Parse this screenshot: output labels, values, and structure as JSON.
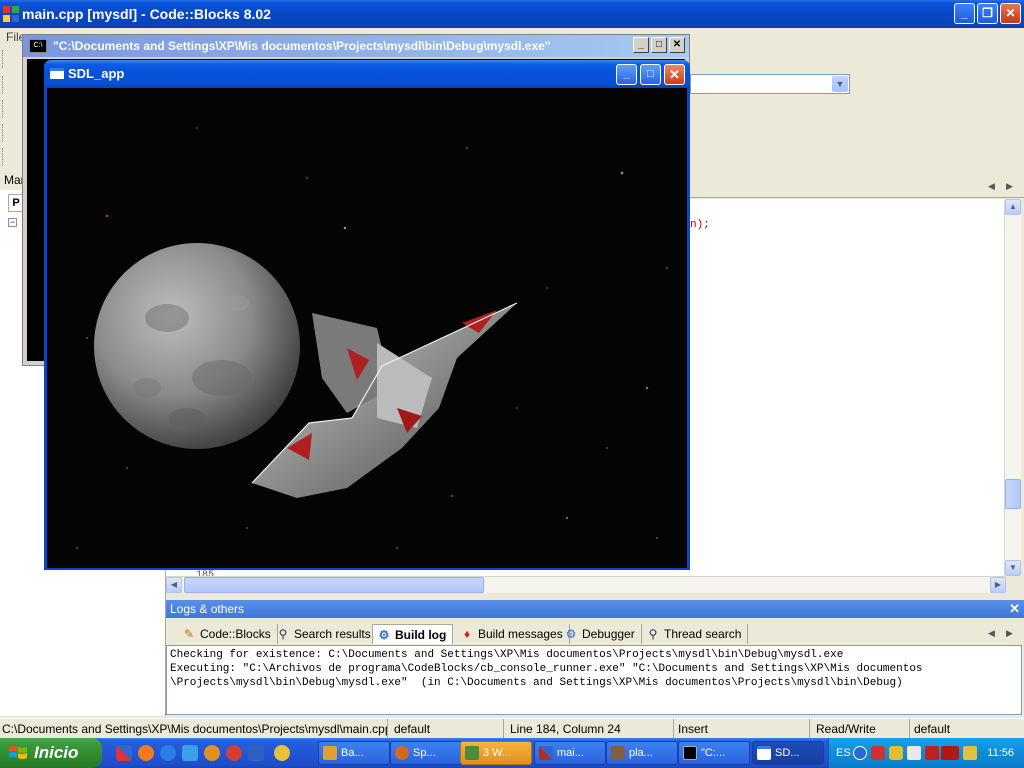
{
  "ide": {
    "title": "main.cpp [mysdl] - Code::Blocks 8.02",
    "menu_first": "File",
    "mgmt_label": "Mar",
    "mgmt_tab": "P",
    "code_fragment": "n);",
    "line_number": "185"
  },
  "console": {
    "icon_text": "C:\\",
    "title": "\"C:\\Documents and Settings\\XP\\Mis documentos\\Projects\\mysdl\\bin\\Debug\\mysdl.exe\""
  },
  "sdl": {
    "title": "SDL_app"
  },
  "logs": {
    "title": "Logs & others",
    "tabs": [
      {
        "label": "Code::Blocks",
        "icon": "pencil-icon"
      },
      {
        "label": "Search results",
        "icon": "magnifier-icon"
      },
      {
        "label": "Build log",
        "icon": "gear-icon"
      },
      {
        "label": "Build messages",
        "icon": "pin-icon"
      },
      {
        "label": "Debugger",
        "icon": "gear-icon"
      },
      {
        "label": "Thread search",
        "icon": "magnifier-icon"
      }
    ],
    "active_tab": "Build log",
    "lines": [
      "Checking for existence: C:\\Documents and Settings\\XP\\Mis documentos\\Projects\\mysdl\\bin\\Debug\\mysdl.exe",
      "Executing: \"C:\\Archivos de programa\\CodeBlocks/cb_console_runner.exe\" \"C:\\Documents and Settings\\XP\\Mis documentos",
      "\\Projects\\mysdl\\bin\\Debug\\mysdl.exe\"  (in C:\\Documents and Settings\\XP\\Mis documentos\\Projects\\mysdl\\bin\\Debug)"
    ]
  },
  "status": {
    "path": "C:\\Documents and Settings\\XP\\Mis documentos\\Projects\\mysdl\\main.cpp",
    "encoding": "default",
    "position": "Line 184, Column 24",
    "mode": "Insert",
    "access": "Read/Write",
    "lexer": "default"
  },
  "taskbar": {
    "start": "Inicio",
    "tasks": [
      {
        "label": "Ba...",
        "color": "#e0a030"
      },
      {
        "label": "Sp...",
        "color": "#d06a20"
      },
      {
        "label": "3 W...",
        "color": "#4a8c3a"
      },
      {
        "label": "mai...",
        "color": "#b03020"
      },
      {
        "label": "pla...",
        "color": "#806040"
      },
      {
        "label": "\"C:...",
        "color": "#000000"
      },
      {
        "label": "SD...",
        "color": "#ffffff"
      }
    ],
    "lang": "ES",
    "clock": "11:56"
  },
  "colors": {
    "xp_blue": "#0a48c8",
    "log_header": "#3d77da",
    "code_red": "#c00000"
  }
}
